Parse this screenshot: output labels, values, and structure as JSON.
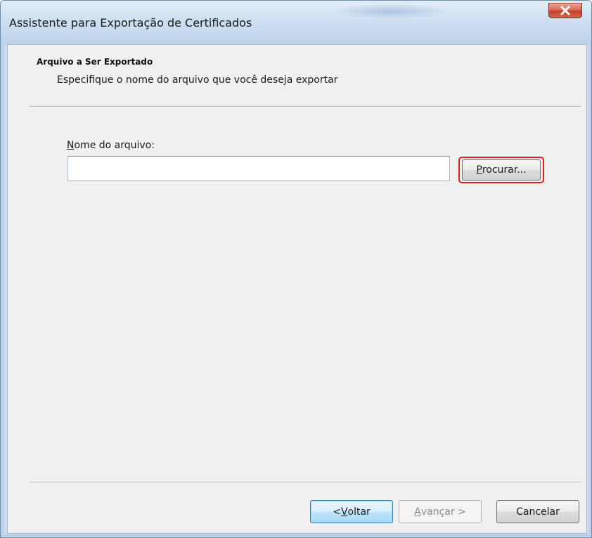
{
  "window": {
    "title": "Assistente para Exportação de Certificados",
    "close_icon": "close-x-icon"
  },
  "header": {
    "title": "Arquivo a Ser Exportado",
    "subtitle": "Especifique o nome do arquivo que você deseja exportar"
  },
  "form": {
    "label_first": "N",
    "label_rest": "ome do arquivo:",
    "filename_value": "",
    "browse_first": "P",
    "browse_rest": "rocurar..."
  },
  "footer": {
    "back_prefix": "< ",
    "back_first": "V",
    "back_rest": "oltar",
    "next_first": "A",
    "next_rest": "vançar >",
    "cancel_label": "Cancelar"
  },
  "colors": {
    "highlight_border": "#e02020",
    "close_button": "#c2412a",
    "client_background": "#f0f0f0"
  }
}
